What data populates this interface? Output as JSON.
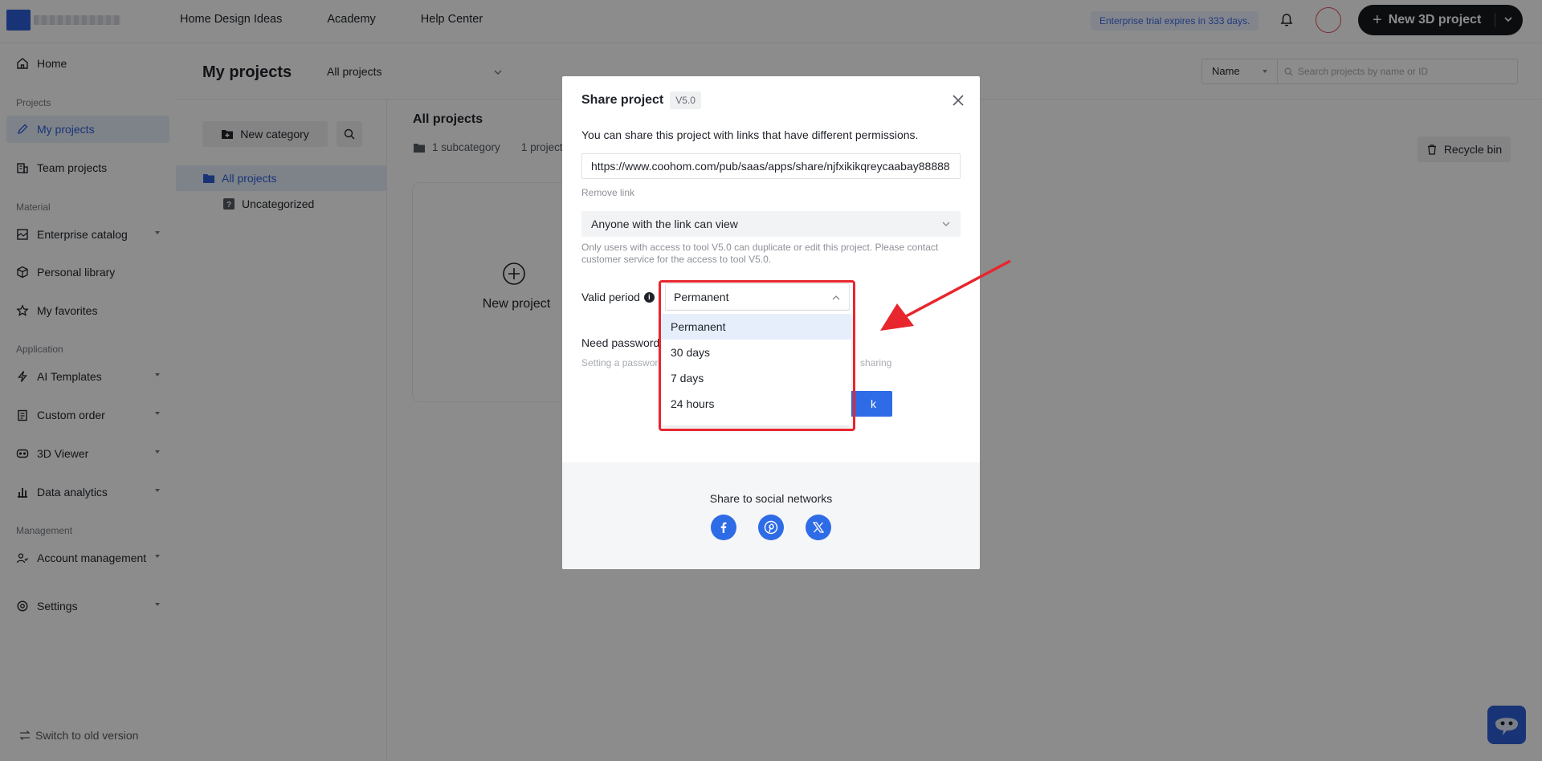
{
  "topbar": {
    "nav": [
      "Home Design Ideas",
      "Academy",
      "Help Center"
    ],
    "trial_text": "Enterprise trial expires in 333 days.",
    "new_project_label": "New 3D project"
  },
  "sidebar": {
    "home": "Home",
    "group_projects": "Projects",
    "my_projects": "My projects",
    "team_projects": "Team projects",
    "group_material": "Material",
    "enterprise_catalog": "Enterprise catalog",
    "personal_library": "Personal library",
    "my_favorites": "My favorites",
    "group_application": "Application",
    "ai_templates": "AI Templates",
    "custom_order": "Custom order",
    "viewer_3d": "3D Viewer",
    "data_analytics": "Data analytics",
    "group_management": "Management",
    "account_management": "Account management",
    "settings": "Settings",
    "switch_old": "Switch to old version"
  },
  "header": {
    "title": "My projects",
    "scope": "All projects",
    "sort": "Name",
    "search_placeholder": "Search projects by name or ID"
  },
  "categories": {
    "new_category": "New category",
    "all_projects": "All projects",
    "uncategorized": "Uncategorized"
  },
  "content": {
    "title": "All projects",
    "subcategory_count": "1 subcategory",
    "project_count": "1 project",
    "recycle_bin": "Recycle bin",
    "new_project": "New project"
  },
  "modal": {
    "title": "Share project",
    "version": "V5.0",
    "description": "You can share this project with links that have different permissions.",
    "link_value": "https://www.coohom.com/pub/saas/apps/share/njfxikikqreycaabay88888",
    "remove_link": "Remove link",
    "permission": "Anyone with the link can view",
    "permission_note": "Only users with access to tool V5.0 can duplicate or edit this project. Please contact customer service for the access to tool V5.0.",
    "valid_period_label": "Valid period",
    "valid_period_value": "Permanent",
    "need_password": "Need password",
    "pw_hint_start": "Setting a passwor",
    "pw_hint_end": "sharing",
    "copy_btn": "k",
    "share_social": "Share to social networks"
  },
  "dropdown": {
    "options": [
      "Permanent",
      "30 days",
      "7 days",
      "24 hours"
    ],
    "selected": "Permanent"
  },
  "colors": {
    "accent": "#2e6be6",
    "highlight": "#e8262e",
    "dark_button": "#15181c"
  }
}
